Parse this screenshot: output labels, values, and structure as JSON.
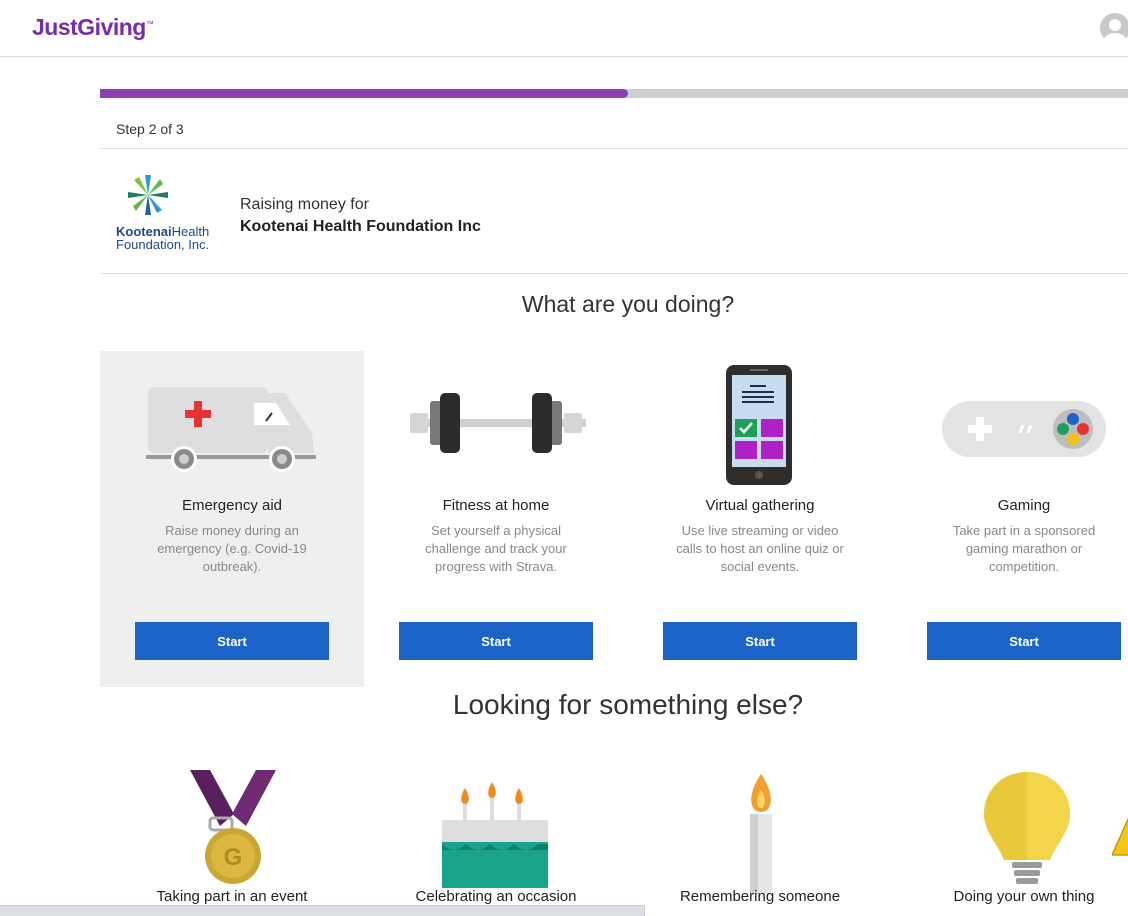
{
  "header": {
    "logo_text": "JustGiving",
    "logo_mark": "™",
    "avatar_icon": "user-avatar-icon"
  },
  "progress": {
    "fraction": 0.514,
    "fill_color": "#8f3fb4",
    "track_color": "#cfcfcf"
  },
  "step_label": "Step 2 of 3",
  "charity": {
    "logo_line1_bold": "Kootenai",
    "logo_line1_rest": "Health",
    "logo_line2": "Foundation, Inc.",
    "raising_label": "Raising money for",
    "name": "Kootenai Health Foundation Inc"
  },
  "heading": "What are you doing?",
  "options": [
    {
      "title": "Emergency aid",
      "description": "Raise money during an emergency (e.g. Covid-19 outbreak).",
      "button": "Start",
      "icon": "ambulance-icon",
      "selected": true
    },
    {
      "title": "Fitness at home",
      "description": "Set yourself a physical challenge and track your progress with Strava.",
      "button": "Start",
      "icon": "dumbbell-icon",
      "selected": false
    },
    {
      "title": "Virtual gathering",
      "description": "Use live streaming or video calls to host an online quiz or social events.",
      "button": "Start",
      "icon": "smartphone-icon",
      "selected": false
    },
    {
      "title": "Gaming",
      "description": "Take part in a sponsored gaming marathon or competition.",
      "button": "Start",
      "icon": "gamepad-icon",
      "selected": false
    }
  ],
  "else_heading": "Looking for something else?",
  "others": [
    {
      "label": "Taking part in an event",
      "icon": "medal-icon"
    },
    {
      "label": "Celebrating an occasion",
      "icon": "birthday-cake-icon"
    },
    {
      "label": "Remembering someone",
      "icon": "candle-icon"
    },
    {
      "label": "Doing your own thing",
      "icon": "lightbulb-icon"
    }
  ],
  "status_bar": "",
  "colors": {
    "brand_purple": "#7a2ca8",
    "button_blue": "#1b63c6"
  }
}
